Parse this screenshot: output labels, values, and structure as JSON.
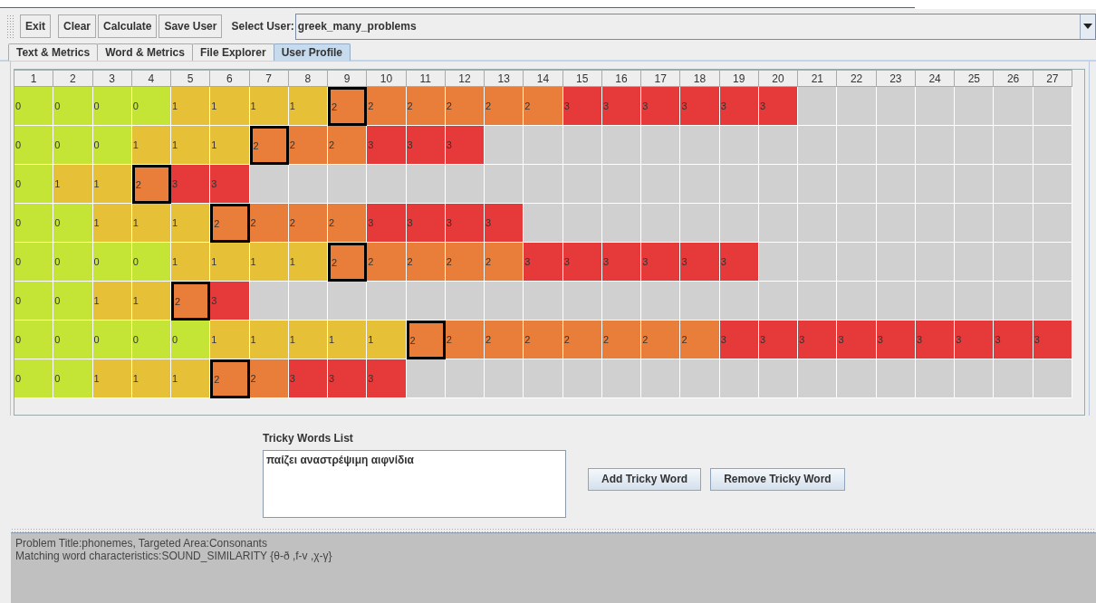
{
  "toolbar": {
    "buttons": [
      "Exit",
      "Clear",
      "Calculate",
      "Save User"
    ],
    "select_label": "Select User:",
    "select_value": "greek_many_problems"
  },
  "tabs": [
    {
      "label": "Text & Metrics",
      "selected": false
    },
    {
      "label": "Word & Metrics",
      "selected": false
    },
    {
      "label": "File Explorer",
      "selected": false
    },
    {
      "label": "User Profile",
      "selected": true
    }
  ],
  "table": {
    "columns": [
      "1",
      "2",
      "3",
      "4",
      "5",
      "6",
      "7",
      "8",
      "9",
      "10",
      "11",
      "12",
      "13",
      "14",
      "15",
      "16",
      "17",
      "18",
      "19",
      "20",
      "21",
      "22",
      "23",
      "24",
      "25",
      "26",
      "27"
    ],
    "rows": [
      {
        "cells": [
          {
            "text": "0",
            "selected": false
          },
          {
            "text": "0",
            "selected": false
          },
          {
            "text": "0",
            "selected": false
          },
          {
            "text": "0",
            "selected": false
          },
          {
            "text": "1",
            "selected": false
          },
          {
            "text": "1",
            "selected": false
          },
          {
            "text": "1",
            "selected": false
          },
          {
            "text": "1",
            "selected": false
          },
          {
            "text": "2",
            "selected": true
          },
          {
            "text": "2",
            "selected": false
          },
          {
            "text": "2",
            "selected": false
          },
          {
            "text": "2",
            "selected": false
          },
          {
            "text": "2",
            "selected": false
          },
          {
            "text": "2",
            "selected": false
          },
          {
            "text": "3",
            "selected": false
          },
          {
            "text": "3",
            "selected": false
          },
          {
            "text": "3",
            "selected": false
          },
          {
            "text": "3",
            "selected": false
          },
          {
            "text": "3",
            "selected": false
          },
          {
            "text": "3",
            "selected": false
          }
        ]
      },
      {
        "cells": [
          {
            "text": "0",
            "selected": false
          },
          {
            "text": "0",
            "selected": false
          },
          {
            "text": "0",
            "selected": false
          },
          {
            "text": "1",
            "selected": false
          },
          {
            "text": "1",
            "selected": false
          },
          {
            "text": "1",
            "selected": false
          },
          {
            "text": "2",
            "selected": true
          },
          {
            "text": "2",
            "selected": false
          },
          {
            "text": "2",
            "selected": false
          },
          {
            "text": "3",
            "selected": false
          },
          {
            "text": "3",
            "selected": false
          },
          {
            "text": "3",
            "selected": false
          }
        ]
      },
      {
        "cells": [
          {
            "text": "0",
            "selected": false
          },
          {
            "text": "1",
            "selected": false
          },
          {
            "text": "1",
            "selected": false
          },
          {
            "text": "2",
            "selected": true
          },
          {
            "text": "3",
            "selected": false
          },
          {
            "text": "3",
            "selected": false
          }
        ]
      },
      {
        "cells": [
          {
            "text": "0",
            "selected": false
          },
          {
            "text": "0",
            "selected": false
          },
          {
            "text": "1",
            "selected": false
          },
          {
            "text": "1",
            "selected": false
          },
          {
            "text": "1",
            "selected": false
          },
          {
            "text": "2",
            "selected": true
          },
          {
            "text": "2",
            "selected": false
          },
          {
            "text": "2",
            "selected": false
          },
          {
            "text": "2",
            "selected": false
          },
          {
            "text": "3",
            "selected": false
          },
          {
            "text": "3",
            "selected": false
          },
          {
            "text": "3",
            "selected": false
          },
          {
            "text": "3",
            "selected": false
          }
        ]
      },
      {
        "cells": [
          {
            "text": "0",
            "selected": false
          },
          {
            "text": "0",
            "selected": false
          },
          {
            "text": "0",
            "selected": false
          },
          {
            "text": "0",
            "selected": false
          },
          {
            "text": "1",
            "selected": false
          },
          {
            "text": "1",
            "selected": false
          },
          {
            "text": "1",
            "selected": false
          },
          {
            "text": "1",
            "selected": false
          },
          {
            "text": "2",
            "selected": true
          },
          {
            "text": "2",
            "selected": false
          },
          {
            "text": "2",
            "selected": false
          },
          {
            "text": "2",
            "selected": false
          },
          {
            "text": "2",
            "selected": false
          },
          {
            "text": "3",
            "selected": false
          },
          {
            "text": "3",
            "selected": false
          },
          {
            "text": "3",
            "selected": false
          },
          {
            "text": "3",
            "selected": false
          },
          {
            "text": "3",
            "selected": false
          },
          {
            "text": "3",
            "selected": false
          }
        ]
      },
      {
        "cells": [
          {
            "text": "0",
            "selected": false
          },
          {
            "text": "0",
            "selected": false
          },
          {
            "text": "1",
            "selected": false
          },
          {
            "text": "1",
            "selected": false
          },
          {
            "text": "2",
            "selected": true
          },
          {
            "text": "3",
            "selected": false
          }
        ]
      },
      {
        "cells": [
          {
            "text": "0",
            "selected": false
          },
          {
            "text": "0",
            "selected": false
          },
          {
            "text": "0",
            "selected": false
          },
          {
            "text": "0",
            "selected": false
          },
          {
            "text": "0",
            "selected": false
          },
          {
            "text": "1",
            "selected": false
          },
          {
            "text": "1",
            "selected": false
          },
          {
            "text": "1",
            "selected": false
          },
          {
            "text": "1",
            "selected": false
          },
          {
            "text": "1",
            "selected": false
          },
          {
            "text": "2",
            "selected": true
          },
          {
            "text": "2",
            "selected": false
          },
          {
            "text": "2",
            "selected": false
          },
          {
            "text": "2",
            "selected": false
          },
          {
            "text": "2",
            "selected": false
          },
          {
            "text": "2",
            "selected": false
          },
          {
            "text": "2",
            "selected": false
          },
          {
            "text": "2",
            "selected": false
          },
          {
            "text": "3",
            "selected": false
          },
          {
            "text": "3",
            "selected": false
          },
          {
            "text": "3",
            "selected": false
          },
          {
            "text": "3",
            "selected": false
          },
          {
            "text": "3",
            "selected": false
          },
          {
            "text": "3",
            "selected": false
          },
          {
            "text": "3",
            "selected": false
          },
          {
            "text": "3",
            "selected": false
          },
          {
            "text": "3",
            "selected": false
          }
        ]
      },
      {
        "cells": [
          {
            "text": "0",
            "selected": false
          },
          {
            "text": "0",
            "selected": false
          },
          {
            "text": "1",
            "selected": false
          },
          {
            "text": "1",
            "selected": false
          },
          {
            "text": "1",
            "selected": false
          },
          {
            "text": "2",
            "selected": true
          },
          {
            "text": "2",
            "selected": false
          },
          {
            "text": "3",
            "selected": false
          },
          {
            "text": "3",
            "selected": false
          },
          {
            "text": "3",
            "selected": false
          }
        ]
      }
    ]
  },
  "tricky_words": {
    "label": "Tricky Words List",
    "value": "παίζει  αναστρέψιμη αιφνίδια",
    "buttons": [
      "Add Tricky Word",
      "Remove Tricky Word"
    ]
  },
  "info": {
    "lines": [
      "Problem Title:phonemes, Targeted Area:Consonants",
      "Matching word characteristics:SOUND_SIMILARITY {θ-ð ,f-v ,χ-γ}"
    ]
  }
}
